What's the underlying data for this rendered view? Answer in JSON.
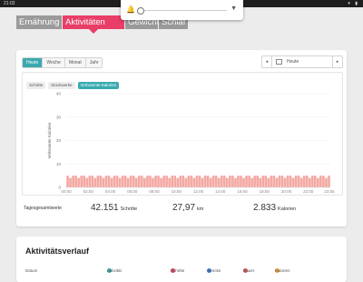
{
  "statusbar": {
    "time": "21:02"
  },
  "tabs": [
    {
      "label": "Ernährung",
      "active": false
    },
    {
      "label": "Aktivitäten",
      "active": true
    },
    {
      "label": "Gewicht",
      "active": false
    },
    {
      "label": "Schlaf",
      "active": false
    }
  ],
  "period_selector": [
    "Heute",
    "Woche",
    "Monat",
    "Jahr"
  ],
  "period_selected": "Heute",
  "date_nav": {
    "prev": "◂",
    "value": "Heute",
    "next": "▸"
  },
  "metric_toggle": [
    "Schritte",
    "Stockwerke",
    "Verbrannte Kalorien"
  ],
  "metric_selected": "Verbrannte Kalorien",
  "chart_data": {
    "type": "bar",
    "ylabel": "Verbrannte Kalorien",
    "ylim": [
      0,
      40
    ],
    "yticks": [
      0,
      10,
      20,
      30,
      40
    ],
    "xticks": [
      "00:00",
      "02:00",
      "04:00",
      "06:00",
      "08:00",
      "10:00",
      "12:00",
      "14:00",
      "16:00",
      "18:00",
      "20:00",
      "22:00",
      "23:55"
    ],
    "bin_minutes": 15,
    "colors": {
      "low": "#f4a8a2",
      "mid": "#f6d36b",
      "high": "#9fd86c"
    },
    "values": [
      5,
      4,
      5,
      5,
      4,
      5,
      5,
      4,
      5,
      5,
      4,
      5,
      5,
      4,
      5,
      5,
      4,
      5,
      5,
      4,
      5,
      5,
      4,
      5,
      5,
      4,
      5,
      5,
      4,
      5,
      5,
      4,
      5,
      5,
      4,
      5,
      5,
      4,
      5,
      5,
      4,
      5,
      5,
      4,
      5,
      5,
      4,
      5,
      5,
      4,
      5,
      5,
      4,
      5,
      5,
      4,
      5,
      5,
      4,
      5,
      5,
      4,
      5,
      5,
      4,
      5,
      5,
      4,
      5,
      5,
      4,
      5,
      5,
      4,
      5,
      5,
      4,
      5,
      5,
      4,
      5,
      5,
      4,
      5,
      5,
      4,
      5,
      5,
      4,
      5,
      5,
      4,
      5,
      5,
      4,
      5,
      5,
      4,
      5,
      5,
      4,
      5,
      5,
      4,
      5,
      5,
      4,
      5,
      5,
      4,
      5,
      5,
      4,
      5,
      5,
      4,
      5,
      5,
      4,
      5,
      5,
      4,
      5,
      5,
      4,
      5,
      5,
      4,
      5,
      5,
      4,
      5,
      5,
      4,
      5,
      5,
      4,
      5,
      5,
      4,
      5,
      5,
      4,
      5,
      5,
      4,
      5,
      5,
      4,
      5,
      5,
      4,
      5,
      5,
      4,
      5,
      5,
      4,
      5,
      5,
      4,
      5,
      5,
      4,
      5,
      5,
      4,
      5,
      5,
      4,
      5,
      5,
      4,
      5,
      5,
      4,
      5,
      5,
      4,
      5,
      5,
      4,
      5,
      5,
      4,
      5,
      5,
      4,
      5,
      5,
      4,
      5,
      5,
      4,
      5,
      5,
      4,
      5,
      5,
      4,
      5,
      5,
      4,
      5,
      5,
      4,
      5,
      5,
      4,
      5,
      5,
      4,
      5,
      5,
      4,
      5,
      5,
      4,
      5,
      5,
      4,
      5,
      5,
      4,
      5,
      5,
      4,
      5,
      5,
      4,
      5,
      5,
      4,
      5,
      5,
      4,
      5,
      5,
      4,
      5,
      5,
      4,
      5,
      5,
      4,
      5,
      5,
      4,
      5,
      5,
      4,
      5,
      5,
      4,
      5,
      5,
      4,
      5,
      5,
      4,
      5,
      5,
      4,
      5,
      5,
      4,
      5,
      5,
      4,
      5,
      5,
      4,
      5,
      5,
      4,
      5,
      5,
      4,
      5,
      5,
      4,
      5,
      5,
      4,
      5,
      5,
      4,
      5,
      5,
      4,
      5,
      5,
      4,
      5,
      5,
      4,
      5,
      5,
      4,
      5,
      5,
      4,
      5,
      5,
      4,
      5,
      5,
      4,
      5,
      5,
      4
    ]
  },
  "totals": {
    "label": "Tagesgesamtwerte",
    "steps": {
      "value": "42.151",
      "unit": "Schritte"
    },
    "distance": {
      "value": "27,97",
      "unit": "km"
    },
    "calories": {
      "value": "2.833",
      "unit": "Kalorien"
    }
  },
  "history": {
    "title": "Aktivitätsverlauf",
    "columns": [
      "Datum",
      "Aktivität",
      "Schritte",
      "Strecke",
      "Dauer",
      "Kalorien"
    ]
  }
}
